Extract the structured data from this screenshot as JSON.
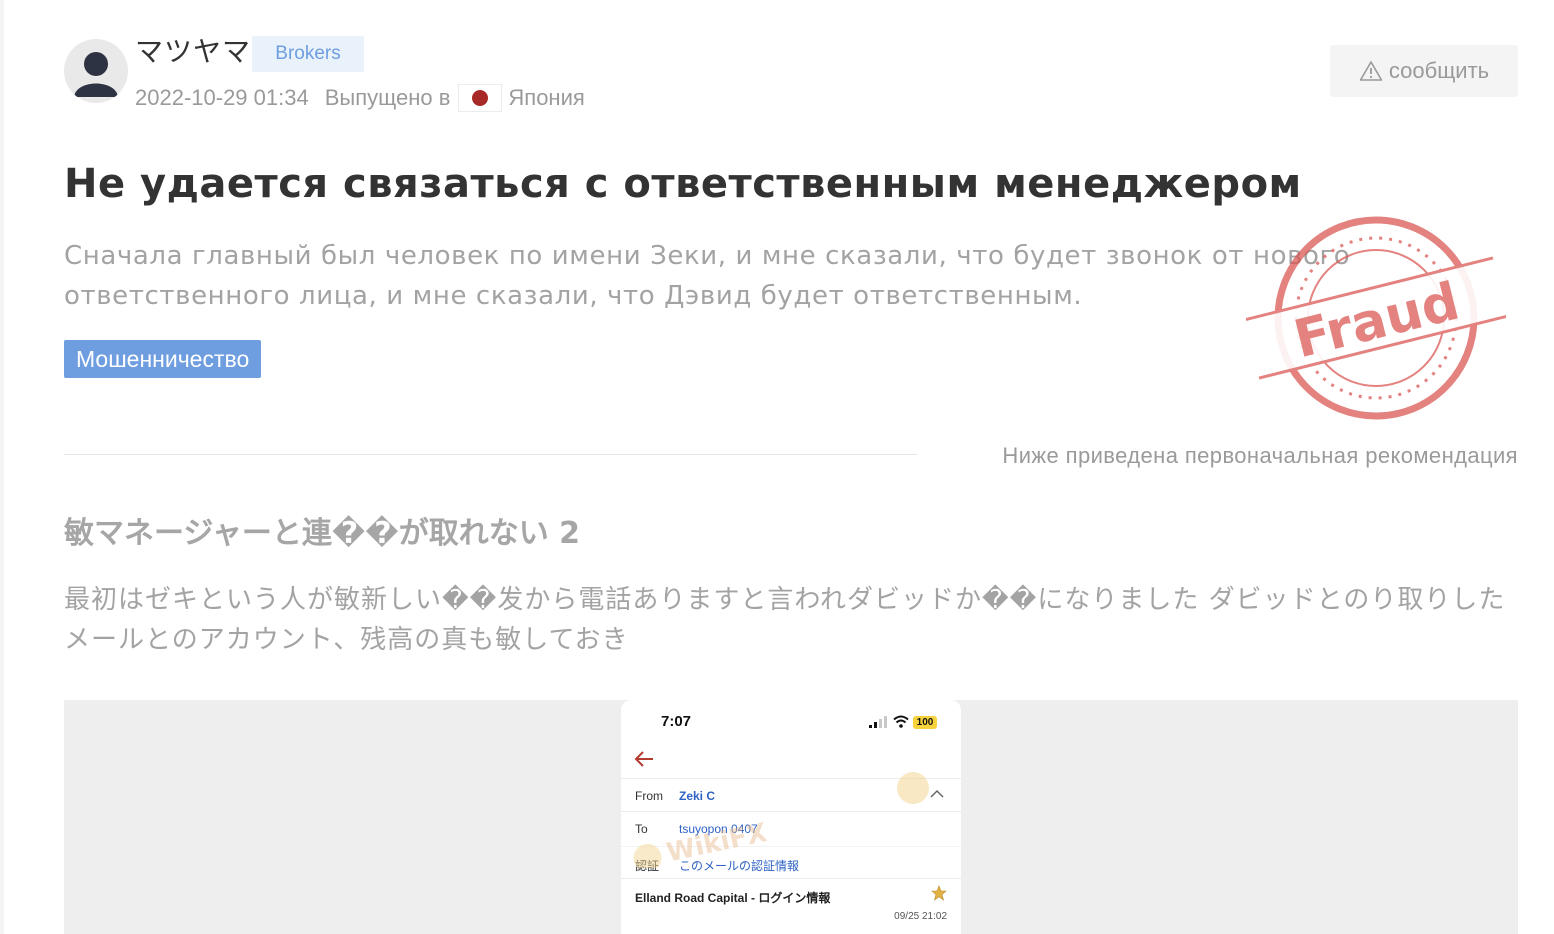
{
  "header": {
    "username": "マツヤマ",
    "broker_tag": "Brokers",
    "date": "2022-10-29 01:34",
    "released_in": "Выпущено в",
    "country": "Япония",
    "report_button": "сообщить"
  },
  "review": {
    "title": "Не удается связаться с ответственным менеджером",
    "body": "Сначала главный был человек по имени Зеки, и мне сказали, что будет звонок от нового ответственного лица, и мне сказали, что Дэвид будет ответственным.",
    "category": "Мошенничество",
    "stamp_text": "Fraud"
  },
  "original": {
    "note": "Ниже приведена первоначальная рекомендация",
    "title": "敏マネージャーと連��が取れない 2",
    "body": "最初はゼキという人が敏新しい��发から電話ありますと言われダビッドか��になりました ダビッドとのり取りしたメールとのアカウント、残高の真も敏しておき"
  },
  "attachment": {
    "time": "7:07",
    "battery": "100",
    "from_label": "From",
    "from_value": "Zeki C",
    "to_label": "To",
    "to_value": "tsuyopon 0407",
    "auth_label": "認証",
    "auth_value": "このメールの認証情報",
    "subject": "Elland Road Capital - ログイン情報",
    "mail_date": "09/25 21:02",
    "watermark": "WikiFX"
  },
  "colors": {
    "accent_blue": "#6e9ee0",
    "tag_bg": "#e9f1fb",
    "stamp_red": "#d9534f",
    "flag_red": "#a72a28"
  },
  "icons": {
    "avatar": "user-silhouette-icon",
    "report": "warning-triangle-icon",
    "stamp": "fraud-stamp-icon",
    "back": "back-arrow-icon",
    "star": "star-icon"
  }
}
